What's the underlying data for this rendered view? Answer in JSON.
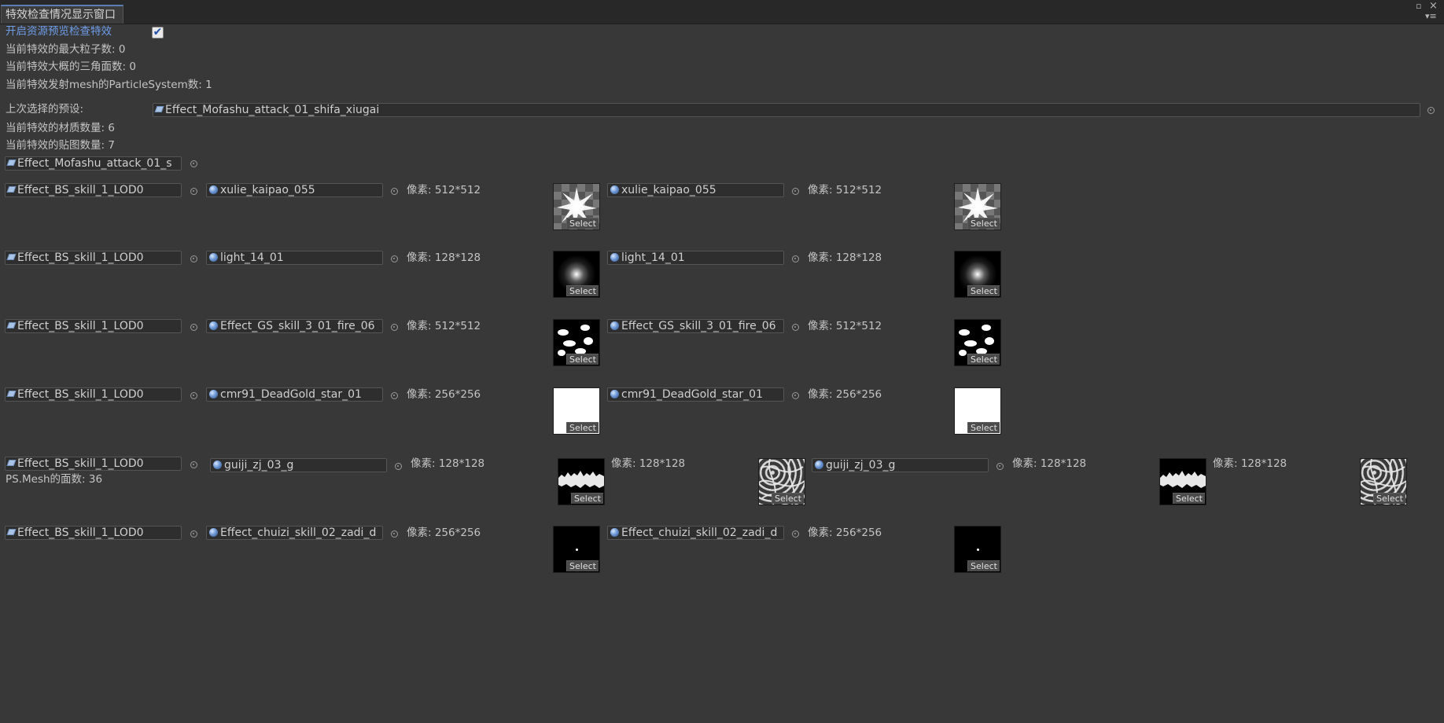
{
  "window": {
    "tab_title": "特效检查情况显示窗口",
    "maximize_glyph": "▫",
    "close_glyph": "×",
    "menu_glyph": "▾≡"
  },
  "stats": {
    "enable_preview_label": "开启资源预览检查特效",
    "enable_preview_checked": true,
    "check_glyph": "✔",
    "max_particles": "当前特效的最大粒子数:  0",
    "triangles": "当前特效大概的三角面数:  0",
    "mesh_ps_count": "当前特效发射mesh的ParticleSystem数:  1",
    "last_prefab_label": "上次选择的预设:",
    "last_prefab_value": "Effect_Mofashu_attack_01_shifa_xiugai",
    "material_count": "当前特效的材质数量:  6",
    "texture_count": "当前特效的贴图数量:  7"
  },
  "root_object": "Effect_Mofashu_attack_01_s",
  "rows": [
    {
      "object": "Effect_BS_skill_1_LOD0",
      "groups": [
        {
          "material": "xulie_kaipao_055",
          "pixels": "像素:  512*512",
          "tex": "starburst",
          "extra": null
        },
        {
          "material": "xulie_kaipao_055",
          "pixels": "像素:  512*512",
          "tex": "starburst",
          "extra": null
        }
      ],
      "note": ""
    },
    {
      "object": "Effect_BS_skill_1_LOD0",
      "groups": [
        {
          "material": "light_14_01",
          "pixels": "像素:  128*128",
          "tex": "glow",
          "extra": null
        },
        {
          "material": "light_14_01",
          "pixels": "像素:  128*128",
          "tex": "glow",
          "extra": null
        }
      ],
      "note": ""
    },
    {
      "object": "Effect_BS_skill_1_LOD0",
      "groups": [
        {
          "material": "Effect_GS_skill_3_01_fire_06",
          "pixels": "像素:  512*512",
          "tex": "fire",
          "extra": null
        },
        {
          "material": "Effect_GS_skill_3_01_fire_06",
          "pixels": "像素:  512*512",
          "tex": "fire",
          "extra": null
        }
      ],
      "note": ""
    },
    {
      "object": "Effect_BS_skill_1_LOD0",
      "groups": [
        {
          "material": "cmr91_DeadGold_star_01",
          "pixels": "像素:  256*256",
          "tex": "white",
          "extra": null
        },
        {
          "material": "cmr91_DeadGold_star_01",
          "pixels": "像素:  256*256",
          "tex": "white",
          "extra": null
        }
      ],
      "note": ""
    },
    {
      "object": "Effect_BS_skill_1_LOD0",
      "groups": [
        {
          "material": "guiji_zj_03_g",
          "pixels": "像素:  128*128",
          "tex": "wave",
          "extra": {
            "pixels": "像素:  128*128",
            "tex": "caustic"
          }
        },
        {
          "material": "guiji_zj_03_g",
          "pixels": "像素:  128*128",
          "tex": "wave",
          "extra": {
            "pixels": "像素:  128*128",
            "tex": "caustic"
          }
        }
      ],
      "note": "PS.Mesh的面数:  36"
    },
    {
      "object": "Effect_BS_skill_1_LOD0",
      "groups": [
        {
          "material": "Effect_chuizi_skill_02_zadi_d",
          "pixels": "像素:  256*256",
          "tex": "dot",
          "extra": null
        },
        {
          "material": "Effect_chuizi_skill_02_zadi_d",
          "pixels": "像素:  256*256",
          "tex": "dot",
          "extra": null
        }
      ],
      "note": ""
    }
  ],
  "select_label": "Select",
  "colors": {
    "background": "#383838",
    "accent_blue": "#6e9de8",
    "field_bg": "#2e2e2e"
  },
  "icons": {
    "prefab": "prefab-icon",
    "material": "material-icon",
    "picker": "object-picker-icon"
  }
}
